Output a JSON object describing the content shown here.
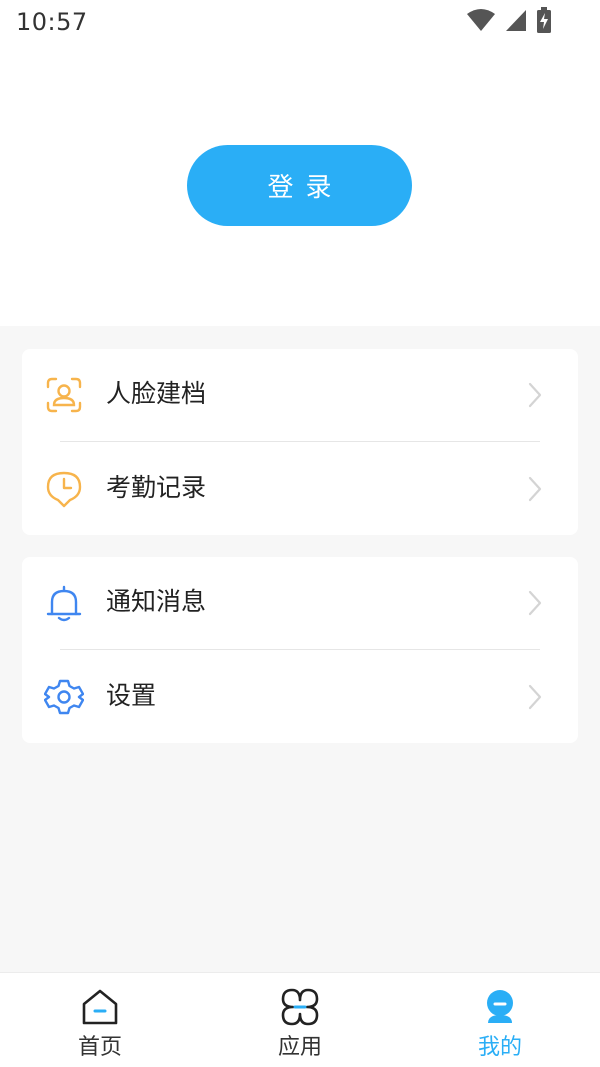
{
  "status_bar": {
    "time": "10:57",
    "icons": [
      "wifi-icon",
      "cellular-signal-icon",
      "battery-charging-icon"
    ]
  },
  "header": {
    "login_label": "登录"
  },
  "menu": {
    "group1": [
      {
        "label": "人脸建档",
        "icon": "face-profile-icon",
        "icon_color": "#f7b44c"
      },
      {
        "label": "考勤记录",
        "icon": "clock-pin-icon",
        "icon_color": "#f7b44c"
      }
    ],
    "group2": [
      {
        "label": "通知消息",
        "icon": "bell-icon",
        "icon_color": "#3f86f0"
      },
      {
        "label": "设置",
        "icon": "gear-icon",
        "icon_color": "#3f86f0"
      }
    ]
  },
  "bottom_nav": {
    "items": [
      {
        "label": "首页",
        "icon": "home-icon",
        "active": false
      },
      {
        "label": "应用",
        "icon": "apps-icon",
        "active": false
      },
      {
        "label": "我的",
        "icon": "profile-icon",
        "active": true
      }
    ]
  },
  "colors": {
    "accent": "#2aaef6",
    "orange": "#f7b44c",
    "blue_icon": "#3f86f0",
    "background_gray": "#f7f7f7",
    "text_dark": "#222222"
  }
}
